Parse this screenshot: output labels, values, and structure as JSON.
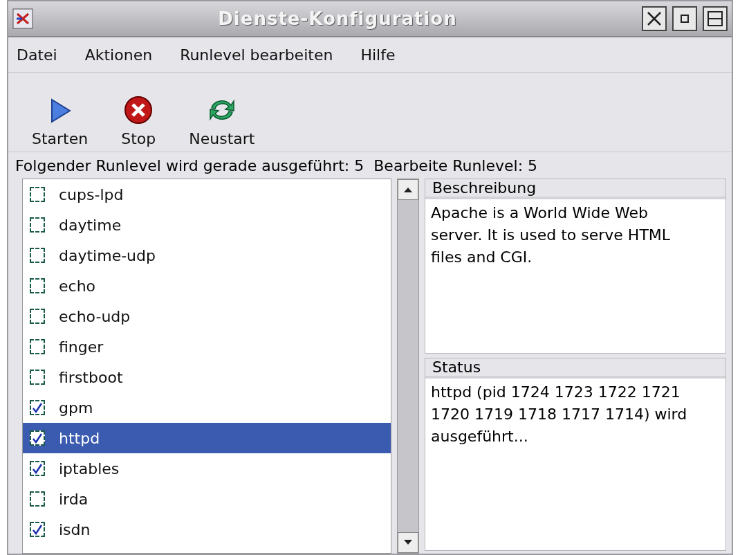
{
  "window": {
    "title": "Dienste-Konfiguration"
  },
  "menu": [
    "Datei",
    "Aktionen",
    "Runlevel bearbeiten",
    "Hilfe"
  ],
  "toolbar": [
    {
      "kind": "start",
      "label": "Starten"
    },
    {
      "kind": "stop",
      "label": "Stop"
    },
    {
      "kind": "restart",
      "label": "Neustart"
    }
  ],
  "runlevel_current": "Folgender Runlevel wird gerade ausgeführt: 5",
  "runlevel_edit": "Bearbeite Runlevel: 5",
  "services": [
    {
      "name": "cups-lpd",
      "checked": false,
      "selected": false
    },
    {
      "name": "daytime",
      "checked": false,
      "selected": false
    },
    {
      "name": "daytime-udp",
      "checked": false,
      "selected": false
    },
    {
      "name": "echo",
      "checked": false,
      "selected": false
    },
    {
      "name": "echo-udp",
      "checked": false,
      "selected": false
    },
    {
      "name": "finger",
      "checked": false,
      "selected": false
    },
    {
      "name": "firstboot",
      "checked": false,
      "selected": false
    },
    {
      "name": "gpm",
      "checked": true,
      "selected": false
    },
    {
      "name": "httpd",
      "checked": true,
      "selected": true
    },
    {
      "name": "iptables",
      "checked": true,
      "selected": false
    },
    {
      "name": "irda",
      "checked": false,
      "selected": false
    },
    {
      "name": "isdn",
      "checked": true,
      "selected": false
    }
  ],
  "description": {
    "title": "Beschreibung",
    "text": "Apache is a World Wide Web server.  It is used to serve HTML files and CGI."
  },
  "status": {
    "title": "Status",
    "text": "httpd (pid 1724 1723 1722 1721 1720 1719 1718 1717 1714) wird ausgeführt..."
  }
}
